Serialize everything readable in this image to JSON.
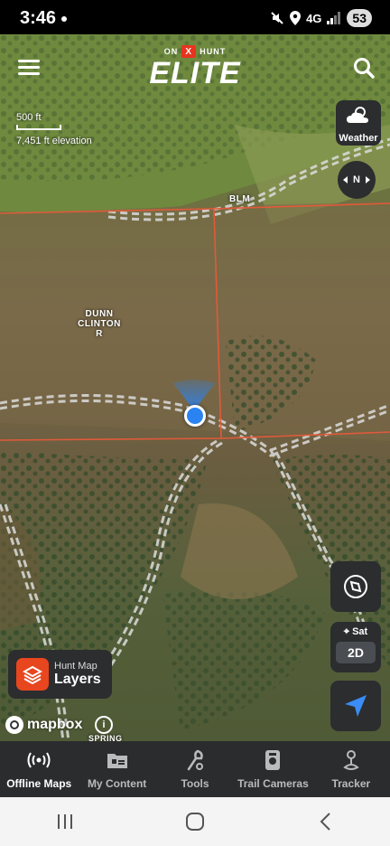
{
  "status_bar": {
    "time": "3:46",
    "network": "4G",
    "battery": "53"
  },
  "header": {
    "brand_prefix": "ON",
    "brand_x": "X",
    "brand_suffix": "HUNT",
    "brand_title": "ELITE"
  },
  "scale": {
    "distance": "500 ft",
    "elevation": "7,451 ft elevation"
  },
  "map_controls": {
    "weather_label": "Weather",
    "north_label": "N",
    "sat_label": "Sat",
    "mode_label": "2D"
  },
  "map_labels": {
    "blm": "BLM",
    "parcel_line1": "DUNN",
    "parcel_line2": "CLINTON",
    "parcel_line3": "R",
    "spring": "SPRING"
  },
  "layers": {
    "subtitle": "Hunt Map",
    "title": "Layers"
  },
  "attribution": {
    "mapbox": "mapbox",
    "info": "i"
  },
  "bottom_nav": [
    {
      "label": "Offline Maps",
      "icon": "offline-maps-icon",
      "active": true
    },
    {
      "label": "My Content",
      "icon": "my-content-icon",
      "active": false
    },
    {
      "label": "Tools",
      "icon": "tools-icon",
      "active": false
    },
    {
      "label": "Trail Cameras",
      "icon": "trail-cameras-icon",
      "active": false
    },
    {
      "label": "Tracker",
      "icon": "tracker-icon",
      "active": false
    }
  ],
  "colors": {
    "accent": "#e8341f",
    "location": "#2b83f2",
    "boundary": "#e05a3a",
    "panel": "#2b2d2f"
  }
}
